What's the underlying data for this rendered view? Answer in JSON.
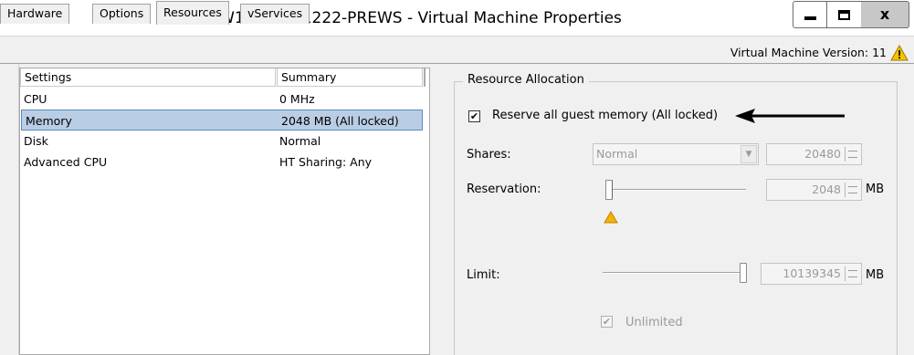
{
  "window": {
    "title": "W10-LTSB-1222-PREWS - Virtual Machine Properties",
    "controls": {
      "minimize": "minimize",
      "maximize": "maximize",
      "close": "x"
    }
  },
  "tabs": [
    {
      "label": "Hardware",
      "active": false
    },
    {
      "label": "Options",
      "active": false
    },
    {
      "label": "Resources",
      "active": true
    },
    {
      "label": "vServices",
      "active": false
    }
  ],
  "vm_version": "Virtual Machine Version: 11",
  "settings_list": {
    "columns": [
      "Settings",
      "Summary"
    ],
    "rows": [
      {
        "setting": "CPU",
        "summary": "0 MHz",
        "selected": false
      },
      {
        "setting": "Memory",
        "summary": "2048 MB (All locked)",
        "selected": true
      },
      {
        "setting": "Disk",
        "summary": "Normal",
        "selected": false
      },
      {
        "setting": "Advanced CPU",
        "summary": "HT Sharing: Any",
        "selected": false
      }
    ]
  },
  "resource_allocation": {
    "group_title": "Resource Allocation",
    "reserve_all_label": "Reserve all guest memory (All locked)",
    "reserve_all_checked": true,
    "shares_label": "Shares:",
    "shares_value": "Normal",
    "shares_number": "20480",
    "reservation_label": "Reservation:",
    "reservation_value": "2048",
    "reservation_unit": "MB",
    "reservation_slider_fraction": 0.0,
    "limit_label": "Limit:",
    "limit_value": "10139345",
    "limit_unit": "MB",
    "limit_slider_fraction": 1.0,
    "unlimited_label": "Unlimited",
    "unlimited_checked": true
  },
  "colors": {
    "selection_bg": "#b9cde5",
    "selection_border": "#5c87bd",
    "warning": "#f5b400",
    "titlebar_close": "#c7c7c7"
  }
}
